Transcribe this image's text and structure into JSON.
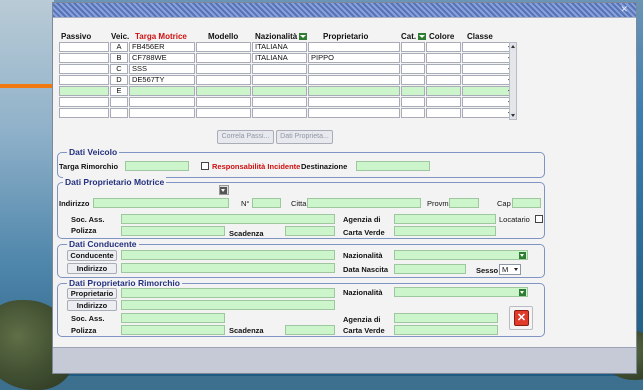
{
  "grid": {
    "headers": {
      "passivo": "Passivo",
      "veic": "Veic.",
      "targa": "Targa Motrice",
      "modello": "Modello",
      "nazionalita": "Nazionalità",
      "proprietario": "Proprietario",
      "cat": "Cat.",
      "colore": "Colore",
      "classe": "Classe"
    },
    "rows": [
      {
        "veic": "A",
        "targa": "FB456ER",
        "modello": "",
        "nazionalita": "ITALIANA",
        "proprietario": ""
      },
      {
        "veic": "B",
        "targa": "CF788WE",
        "modello": "",
        "nazionalita": "ITALIANA",
        "proprietario": "PIPPO"
      },
      {
        "veic": "C",
        "targa": "SSS",
        "modello": "",
        "nazionalita": "",
        "proprietario": ""
      },
      {
        "veic": "D",
        "targa": "DE567TY",
        "modello": "",
        "nazionalita": "",
        "proprietario": ""
      },
      {
        "veic": "E",
        "targa": "",
        "modello": "",
        "nazionalita": "",
        "proprietario": ""
      },
      {
        "veic": "",
        "targa": "",
        "modello": "",
        "nazionalita": "",
        "proprietario": ""
      },
      {
        "veic": "",
        "targa": "",
        "modello": "",
        "nazionalita": "",
        "proprietario": ""
      }
    ]
  },
  "buttons": {
    "correla_passivi": "Correla Passi...",
    "dati_proprieta": "Dati Proprieta..."
  },
  "dati_veicolo": {
    "title": "Dati Veicolo",
    "targa_rimorchio": "Targa Rimorchio",
    "responsabilita": "Responsabilità Incidente",
    "destinazione": "Destinazione"
  },
  "dati_proprietario_motrice": {
    "title": "Dati Proprietario Motrice",
    "indirizzo": "Indirizzo",
    "numero": "N°",
    "citta": "Citta",
    "provincia": "Provm",
    "cap": "Cap",
    "soc_ass": "Soc. Ass.",
    "agenzia": "Agenzia di",
    "locatario": "Locatario",
    "polizza": "Polizza",
    "scadenza": "Scadenza",
    "carta_verde": "Carta Verde"
  },
  "dati_conducente": {
    "title": "Dati Conducente",
    "conducente_btn": "Conducente",
    "indirizzo_btn": "Indirizzo",
    "nazionalita": "Nazionalità",
    "data_nascita": "Data Nascita",
    "sesso": "Sesso",
    "sesso_value": "M"
  },
  "dati_proprietario_rimorchio": {
    "title": "Dati Proprietario Rimorchio",
    "proprietario_btn": "Proprietario",
    "indirizzo_btn": "Indirizzo",
    "nazionalita": "Nazionalità",
    "soc_ass": "Soc. Ass.",
    "agenzia": "Agenzia di",
    "polizza": "Polizza",
    "scadenza": "Scadenza",
    "carta_verde": "Carta Verde"
  },
  "icons": {
    "arrow": "arrow-right-icon",
    "close": "close-icon",
    "window_close": "window-close-icon"
  },
  "colors": {
    "field_green": "#ccf5cc",
    "group_title": "#24317f",
    "arrow_orange": "#f07a10",
    "required_red": "#d01010"
  }
}
